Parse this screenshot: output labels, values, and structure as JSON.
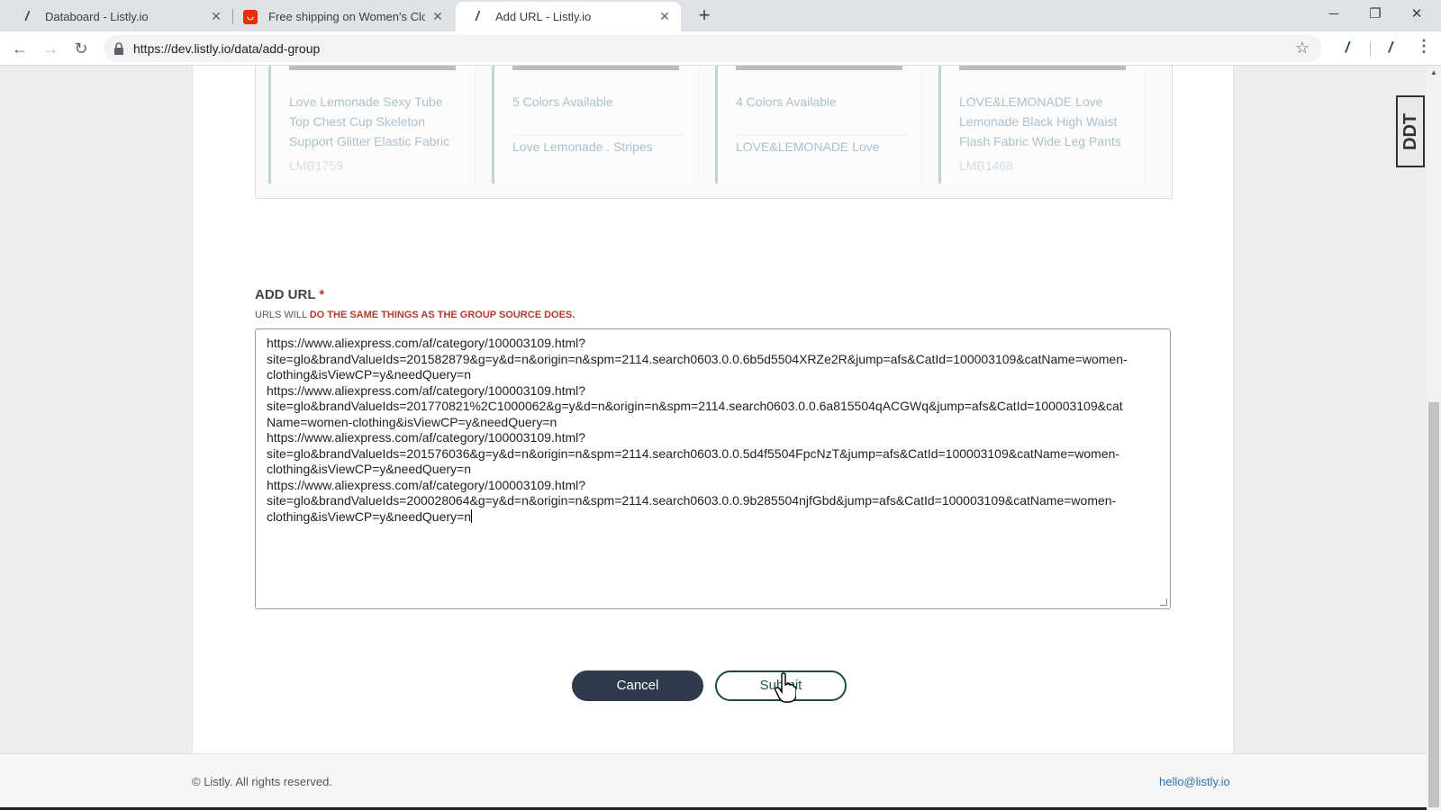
{
  "browser": {
    "tabs": [
      {
        "title": "Databoard - Listly.io",
        "favicon": "listly-icon",
        "active": false
      },
      {
        "title": "Free shipping on Women's Clot",
        "favicon": "aliexpress-icon",
        "active": false
      },
      {
        "title": "Add URL - Listly.io",
        "favicon": "listly-icon",
        "active": true
      }
    ],
    "new_tab": "+",
    "url": "https://dev.listly.io/data/add-group",
    "window_controls": {
      "minimize": "─",
      "maximize": "❐",
      "close": "✕"
    }
  },
  "preview": {
    "products": [
      {
        "title": "Love Lemonade Sexy Tube Top Chest Cup Skeleton Support Glitter Elastic Fabric",
        "extra": "LMB1759"
      },
      {
        "title": "5 Colors Available",
        "extra": "Love Lemonade . Stripes"
      },
      {
        "title": "4 Colors Available",
        "extra": "LOVE&LEMONADE Love"
      },
      {
        "title": "LOVE&LEMONADE Love Lemonade Black High Waist Flash Fabric Wide Leg Pants",
        "extra": "LMB1468"
      }
    ]
  },
  "form": {
    "label": "ADD URL",
    "required_mark": "*",
    "hint_prefix": "URLS WILL ",
    "hint_emphasis": "DO THE SAME THINGS AS THE GROUP SOURCE DOES.",
    "textarea_lines": [
      "https://www.aliexpress.com/af/category/100003109.html?",
      "site=glo&brandValueIds=201582879&g=y&d=n&origin=n&spm=2114.search0603.0.0.6b5d5504XRZe2R&jump=afs&CatId=100003109&catName=women-",
      "clothing&isViewCP=y&needQuery=n",
      "https://www.aliexpress.com/af/category/100003109.html?",
      "site=glo&brandValueIds=201770821%2C1000062&g=y&d=n&origin=n&spm=2114.search0603.0.0.6a815504qACGWq&jump=afs&CatId=100003109&cat",
      "Name=women-clothing&isViewCP=y&needQuery=n",
      "https://www.aliexpress.com/af/category/100003109.html?",
      "site=glo&brandValueIds=201576036&g=y&d=n&origin=n&spm=2114.search0603.0.0.5d4f5504FpcNzT&jump=afs&CatId=100003109&catName=women-",
      "clothing&isViewCP=y&needQuery=n",
      "https://www.aliexpress.com/af/category/100003109.html?",
      "site=glo&brandValueIds=200028064&g=y&d=n&origin=n&spm=2114.search0603.0.0.9b285504njfGbd&jump=afs&CatId=100003109&catName=women-",
      "clothing&isViewCP=y&needQuery=n"
    ],
    "cancel_label": "Cancel",
    "submit_label": "Submit"
  },
  "footer": {
    "copyright": "© Listly. All rights reserved.",
    "email": "hello@listly.io"
  },
  "extension_badge": "DDT",
  "colors": {
    "brand_green": "#1d5a43",
    "cancel_bg": "#2f3a4a",
    "required_red": "#c0392b",
    "link_blue": "#2f6fb0"
  }
}
